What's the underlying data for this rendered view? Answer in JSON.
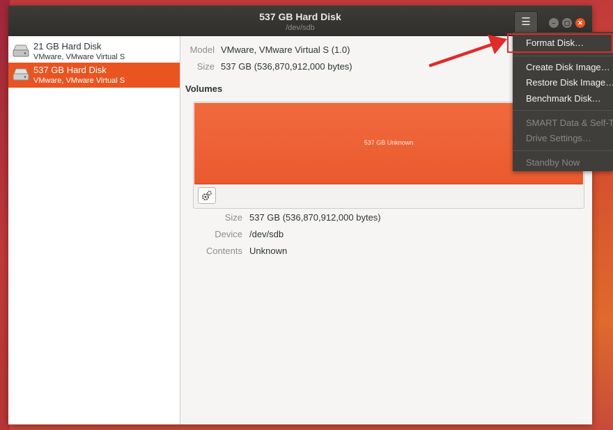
{
  "window": {
    "title": "537 GB Hard Disk",
    "subtitle": "/dev/sdb"
  },
  "titlebar": {
    "menu_icon": "☰",
    "minimize_icon": "–",
    "maximize_icon": "▢",
    "close_icon": "✕"
  },
  "sidebar": {
    "items": [
      {
        "name": "21 GB Hard Disk",
        "sub": "VMware, VMware Virtual S",
        "selected": false
      },
      {
        "name": "537 GB Hard Disk",
        "sub": "VMware, VMware Virtual S",
        "selected": true
      }
    ]
  },
  "details": {
    "model_label": "Model",
    "model_value": "VMware, VMware Virtual S (1.0)",
    "size_label": "Size",
    "size_value": "537 GB (536,870,912,000 bytes)"
  },
  "volumes": {
    "title": "Volumes",
    "bar_label": "537 GB Unknown",
    "size_label": "Size",
    "size_value": "537 GB (536,870,912,000 bytes)",
    "device_label": "Device",
    "device_value": "/dev/sdb",
    "contents_label": "Contents",
    "contents_value": "Unknown"
  },
  "menu": {
    "items": [
      {
        "label": "Format Disk…",
        "enabled": true
      },
      {
        "label": "Create Disk Image…",
        "enabled": true
      },
      {
        "label": "Restore Disk Image…",
        "enabled": true
      },
      {
        "label": "Benchmark Disk…",
        "enabled": true
      },
      {
        "label": "SMART Data & Self-Tests…",
        "enabled": false
      },
      {
        "label": "Drive Settings…",
        "enabled": false
      },
      {
        "label": "Standby Now",
        "enabled": false
      }
    ]
  },
  "colors": {
    "accent": "#e95420",
    "annotation": "#e02b2b"
  }
}
